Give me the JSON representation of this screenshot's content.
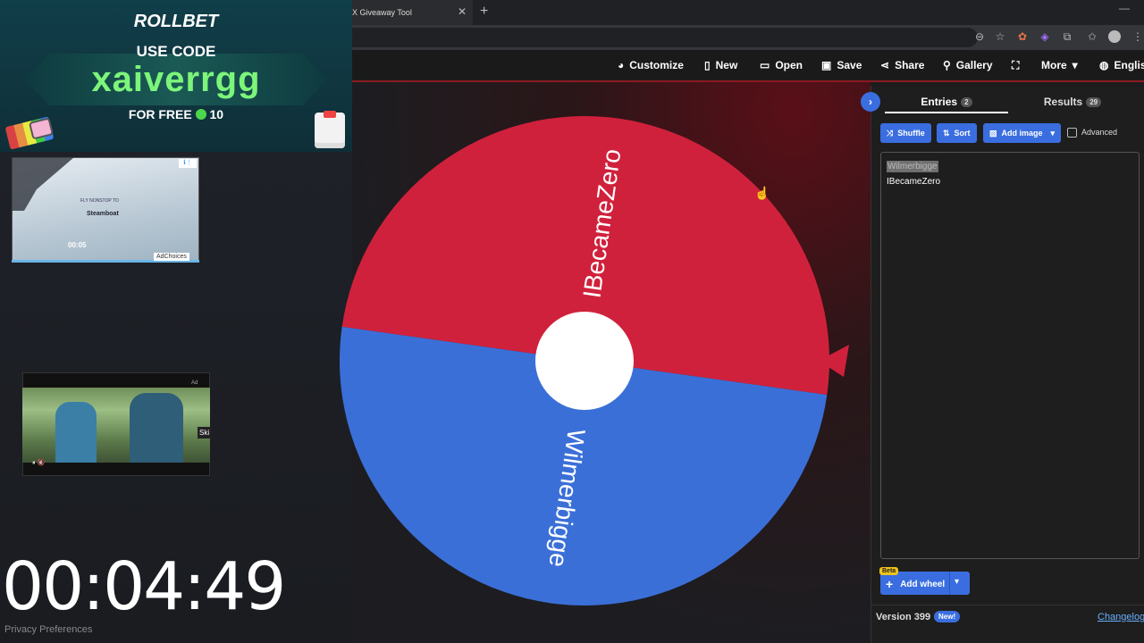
{
  "browser": {
    "tab_title": "X Giveaway Tool",
    "tab_close": "✕",
    "new_tab": "+",
    "minimize": "—"
  },
  "header": {
    "buttons": [
      {
        "label": "Customize",
        "icon": "palette-icon",
        "glyph": "🎨"
      },
      {
        "label": "New",
        "icon": "file-icon",
        "glyph": "📄"
      },
      {
        "label": "Open",
        "icon": "folder-icon",
        "glyph": "📂"
      },
      {
        "label": "Save",
        "icon": "save-icon",
        "glyph": "💾"
      },
      {
        "label": "Share",
        "icon": "share-icon",
        "glyph": "⤴"
      },
      {
        "label": "Gallery",
        "icon": "search-icon",
        "glyph": "🔍"
      },
      {
        "label": "More",
        "icon": "chevron-down-icon",
        "glyph": "▾"
      },
      {
        "label": "Englis",
        "icon": "globe-icon",
        "glyph": "🌐"
      }
    ]
  },
  "wheel": {
    "segments": [
      {
        "label": "IBecameZero",
        "color": "#d0213c"
      },
      {
        "label": "Wilmerbigge",
        "color": "#3b6fd8"
      }
    ],
    "center_color": "#ffffff",
    "pointer_color": "#d0213c"
  },
  "panel": {
    "tabs": [
      {
        "label": "Entries",
        "count": "2"
      },
      {
        "label": "Results",
        "count": "29"
      }
    ],
    "buttons": {
      "shuffle": "Shuffle",
      "sort": "Sort",
      "add_image": "Add image",
      "advanced": "Advanced"
    },
    "entries": [
      "Wilmerbigge",
      "IBecameZero"
    ],
    "add_wheel": "Add wheel",
    "beta": "Beta",
    "version": "Version 399",
    "new_badge": "New!",
    "changelog": "Changelog"
  },
  "overlay": {
    "promo": {
      "brand": "ROLLBET",
      "use_code": "USE CODE",
      "code": "xaiverrgg",
      "free_prefix": "FOR FREE",
      "free_amount": "10"
    },
    "ad1": {
      "line1": "FLY NONSTOP TO",
      "line2": "Steamboat",
      "time": "00:05",
      "choices": "AdChoices",
      "info": "ℹ⋮"
    },
    "ad2": {
      "label": "Ad",
      "skip": "Ski",
      "controls": "⏸  🔇"
    },
    "timer": "00:04:49",
    "privacy": "Privacy Preferences"
  }
}
